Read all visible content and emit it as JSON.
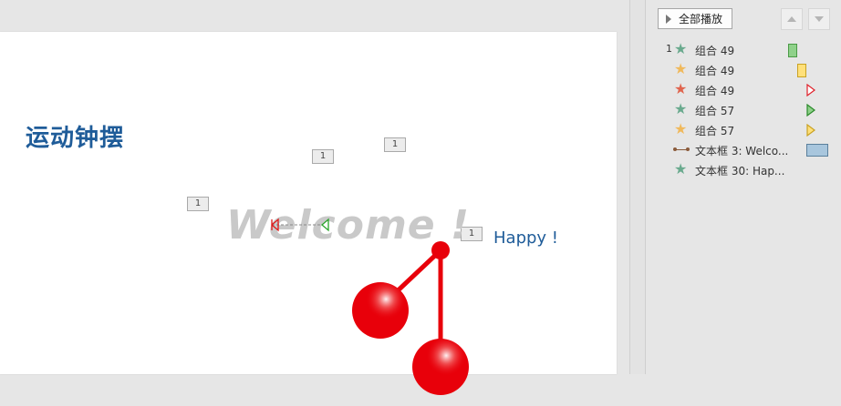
{
  "slide": {
    "title": "运动钟摆",
    "welcome_text": "Welcome !",
    "happy_text": "Happy !",
    "anim_tags": [
      "1",
      "1",
      "1",
      "1"
    ]
  },
  "pane": {
    "play_all_label": "全部播放",
    "items": [
      {
        "num": "1",
        "label": "组合 49",
        "star_color": "#6aaa8e",
        "icon": "star-icon",
        "effect_icon": "rect-green-icon"
      },
      {
        "num": "",
        "label": "组合 49",
        "star_color": "#f0b95c",
        "icon": "star-icon",
        "effect_icon": "rect-yellow-icon"
      },
      {
        "num": "",
        "label": "组合 49",
        "star_color": "#e0654e",
        "icon": "star-icon",
        "effect_icon": "triangle-red-icon"
      },
      {
        "num": "",
        "label": "组合 57",
        "star_color": "#6aaa8e",
        "icon": "star-icon",
        "effect_icon": "triangle-green-icon"
      },
      {
        "num": "",
        "label": "组合 57",
        "star_color": "#f0b95c",
        "icon": "star-icon",
        "effect_icon": "triangle-yellow-icon"
      },
      {
        "num": "",
        "label": "文本框 3: Welco...",
        "star_color": "#8a5a3a",
        "icon": "motion-path-icon",
        "effect_icon": "rect-blue-icon"
      },
      {
        "num": "",
        "label": "文本框 30: Hap...",
        "star_color": "#6aaa8e",
        "icon": "star-icon",
        "effect_icon": ""
      }
    ]
  },
  "colors": {
    "cherry_red": "#e8000a",
    "title_blue": "#1f5c99",
    "welcome_gray": "#c9c9c9"
  }
}
